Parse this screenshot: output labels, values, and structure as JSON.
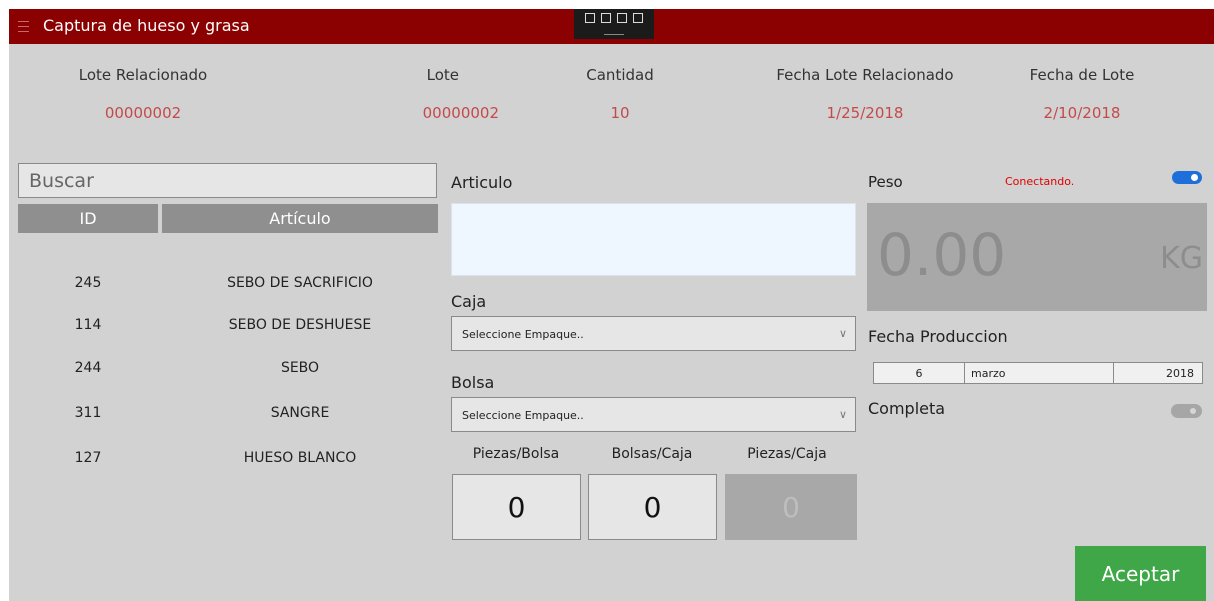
{
  "window": {
    "title": "Captura de hueso y grasa"
  },
  "debug_toolbar": {
    "icons": [
      "select-element-icon",
      "display-layout-icon",
      "track-focus-icon",
      "hot-reload-icon"
    ]
  },
  "summary": [
    {
      "label": "Lote Relacionado",
      "value": "00000002"
    },
    {
      "label": "Lote",
      "value": "00000002"
    },
    {
      "label": "Cantidad",
      "value": "10"
    },
    {
      "label": "Fecha Lote Relacionado",
      "value": "1/25/2018"
    },
    {
      "label": "Fecha de Lote",
      "value": "2/10/2018"
    }
  ],
  "search": {
    "placeholder": "Buscar"
  },
  "table": {
    "headers": {
      "id": "ID",
      "article": "Artículo"
    },
    "rows": [
      {
        "id": "245",
        "article": "SEBO DE SACRIFICIO"
      },
      {
        "id": "114",
        "article": "SEBO DE DESHUESE"
      },
      {
        "id": "244",
        "article": "SEBO"
      },
      {
        "id": "311",
        "article": "SANGRE"
      },
      {
        "id": "127",
        "article": "HUESO BLANCO"
      }
    ]
  },
  "form": {
    "articulo_label": "Articulo",
    "articulo_value": "",
    "caja_label": "Caja",
    "caja_selected": "Seleccione Empaque..",
    "bolsa_label": "Bolsa",
    "bolsa_selected": "Seleccione Empaque..",
    "quantities": [
      {
        "label": "Piezas/Bolsa",
        "value": "0"
      },
      {
        "label": "Bolsas/Caja",
        "value": "0"
      },
      {
        "label": "Piezas/Caja",
        "value": "0"
      }
    ]
  },
  "scale": {
    "label": "Peso",
    "status": "Conectando.",
    "connected_toggle": true,
    "weight": "0.00",
    "unit": "KG"
  },
  "production_date": {
    "label": "Fecha Produccion",
    "day": "6",
    "month": "marzo",
    "year": "2018"
  },
  "complete": {
    "label": "Completa",
    "toggle": false
  },
  "actions": {
    "accept_label": "Aceptar"
  },
  "colors": {
    "titlebar": "#8b0000",
    "value_text": "#c44a4a",
    "status_text": "#e00000",
    "toggle_on": "#1e6fd9",
    "accept": "#3fa748"
  }
}
